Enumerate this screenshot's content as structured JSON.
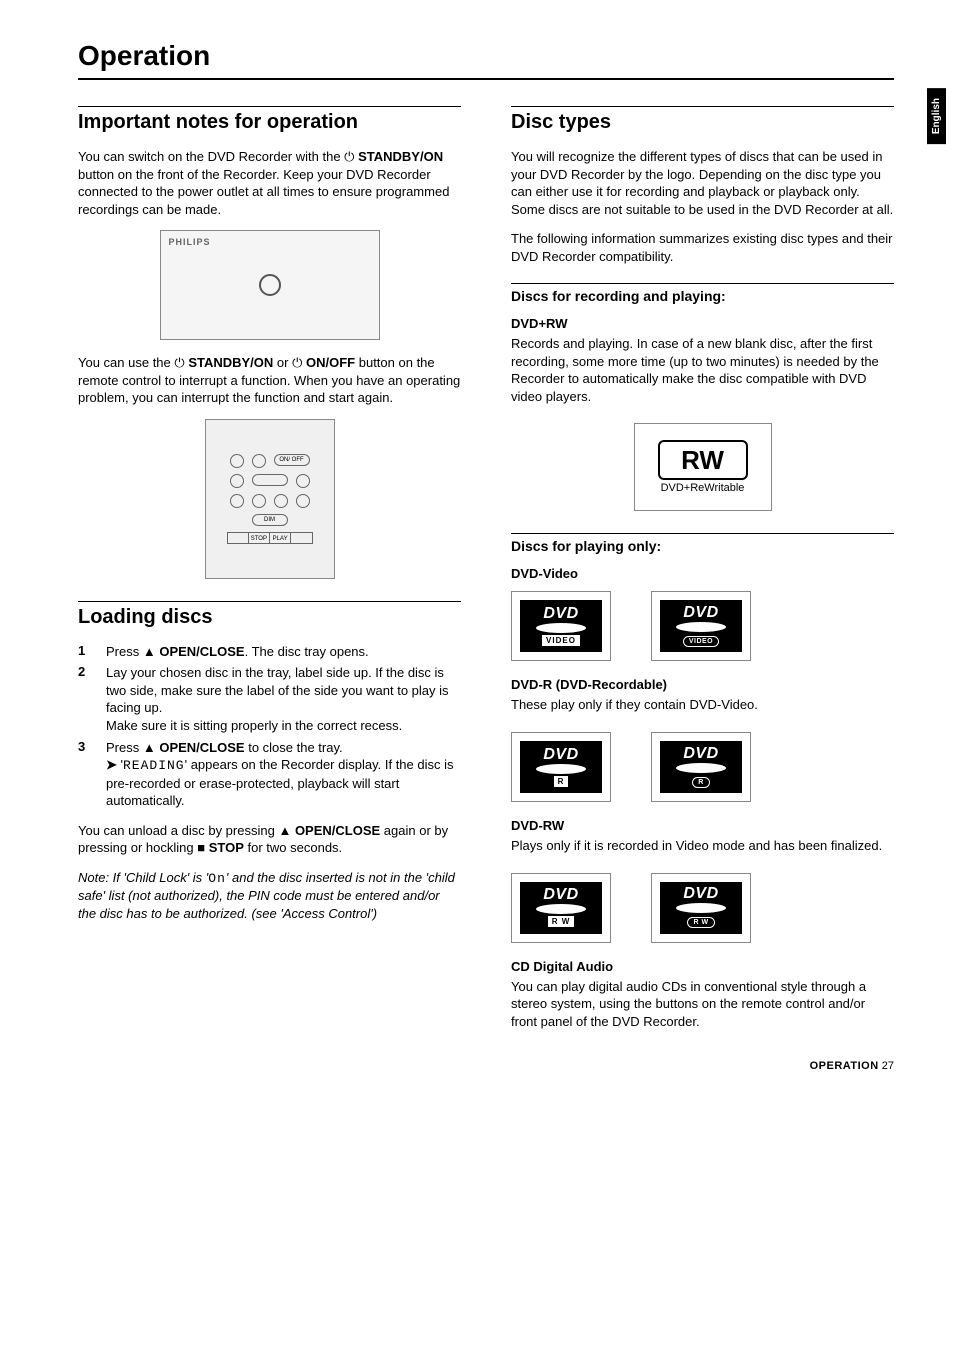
{
  "sideTab": "English",
  "pageTitle": "Operation",
  "left": {
    "sec1": {
      "title": "Important notes for operation",
      "p1a": "You can switch on the DVD Recorder with the ",
      "p1b": "STANDBY/ON",
      "p1c": " button on the front of the Recorder. Keep your DVD Recorder connected to the power outlet at all times to ensure programmed recordings can be made.",
      "deviceBrand": "PHILIPS",
      "p2a": "You can use the ",
      "p2b": "STANDBY/ON",
      "p2c": " or ",
      "p2d": "ON/OFF",
      "p2e": " button on the remote control to interrupt a function. When you have an operating problem, you can interrupt the function and start again.",
      "remoteLabels": {
        "dim": "DIM",
        "stop": "STOP",
        "play": "PLAY",
        "onoff": "ON/ OFF"
      }
    },
    "sec2": {
      "title": "Loading discs",
      "steps": {
        "s1num": "1",
        "s1a": "Press ",
        "s1b": "OPEN/CLOSE",
        "s1c": ". The disc tray opens.",
        "s2num": "2",
        "s2": "Lay your chosen disc in the tray, label side up. If the disc is two side, make sure the label of the side you want to play is facing up.\nMake sure it is sitting properly in the correct recess.",
        "s3num": "3",
        "s3a": "Press ",
        "s3b": "OPEN/CLOSE",
        "s3c": " to close the tray.",
        "s3arrow": "➤",
        "s3d": " '",
        "s3e": "READING",
        "s3f": "' appears on the Recorder display. If the disc is pre-recorded or erase-protected, playback will start automatically."
      },
      "p3a": "You can unload a disc by pressing ",
      "p3b": "OPEN/CLOSE",
      "p3c": " again or by pressing or hockling ",
      "p3d": "STOP",
      "p3e": " for two seconds.",
      "noteA": "Note: If 'Child Lock' is '",
      "noteOn": "On",
      "noteB": "' and the disc inserted is not in the 'child safe' list (not authorized), the PIN code must be entered and/or the disc has to be authorized. (see 'Access Control')"
    }
  },
  "right": {
    "sec1": {
      "title": "Disc types",
      "p1": "You will recognize the different types of discs that can be used in your DVD Recorder by the logo. Depending on the disc type you can either use it for recording and playback or playback only. Some discs are not suitable to be used in the DVD Recorder at all.",
      "p2": "The following information summarizes existing disc types and their DVD Recorder compatibility."
    },
    "recPlay": {
      "title": "Discs for recording and playing:",
      "dvdrwTitle": "DVD+RW",
      "dvdrwText": "Records and playing. In case of a new blank disc, after the first recording, some more time (up to two minutes) is needed by the Recorder to automatically make the disc compatible with DVD video players.",
      "rwLogoTop": "RW",
      "rwLogoBottom": "DVD+ReWritable"
    },
    "playOnly": {
      "title": "Discs for playing only:",
      "dvdVideoTitle": "DVD-Video",
      "dvdLogoTop": "DVD",
      "dvdLogoVideo": "VIDEO",
      "dvdrTitle": "DVD-R (DVD-Recordable)",
      "dvdrText": "These play only if they contain DVD-Video.",
      "dvdrLabel": "R",
      "dvdrwTitle": "DVD-RW",
      "dvdrwText": "Plays only if it is recorded in Video mode and has been finalized.",
      "dvdrwLabel": "R W",
      "cdTitle": "CD Digital Audio",
      "cdText": "You can play digital audio CDs in conventional style through a stereo system, using the buttons on the remote control and/or front panel of the DVD Recorder."
    }
  },
  "footer": {
    "label": "OPERATION",
    "page": "27"
  }
}
